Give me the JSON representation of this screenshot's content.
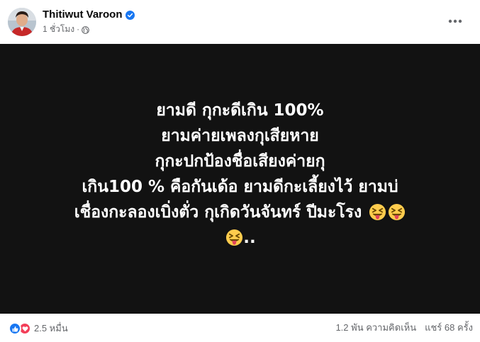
{
  "post": {
    "author": "Thitiwut Varoon",
    "time": "1 ชั่วโมง",
    "separator": "·",
    "text_lines": [
      "ยามดี กุกะดีเกิน 100%",
      "ยามค่ายเพลงกุเสียหาย",
      "กุกะปกป้องชื่อเสียงค่ายกุ",
      "เกิน100 % คือกันเด้อ ยามดีกะเลี้ยงไว้ ยามบ่",
      "เชื่องกะลองเบิ่งตั่ว กุเกิดวันจันทร์ ปีมะโรง",
      ".."
    ]
  },
  "footer": {
    "reaction_count": "2.5 หมื่น",
    "comments": "1.2 พัน ความคิดเห็น",
    "shares": "แชร์ 68 ครั้ง"
  },
  "icons": {
    "verified": "verified-badge-icon",
    "privacy": "globe-icon",
    "more": "more-options-icon",
    "like": "like-reaction-icon",
    "love": "love-reaction-icon",
    "emoji": "squinting-tongue-emoji"
  },
  "colors": {
    "post_background": "#121212",
    "post_text": "#ffffff",
    "verified": "#1877f2",
    "like": "#1877f2",
    "love": "#f33e58",
    "secondary_text": "#65676b"
  }
}
